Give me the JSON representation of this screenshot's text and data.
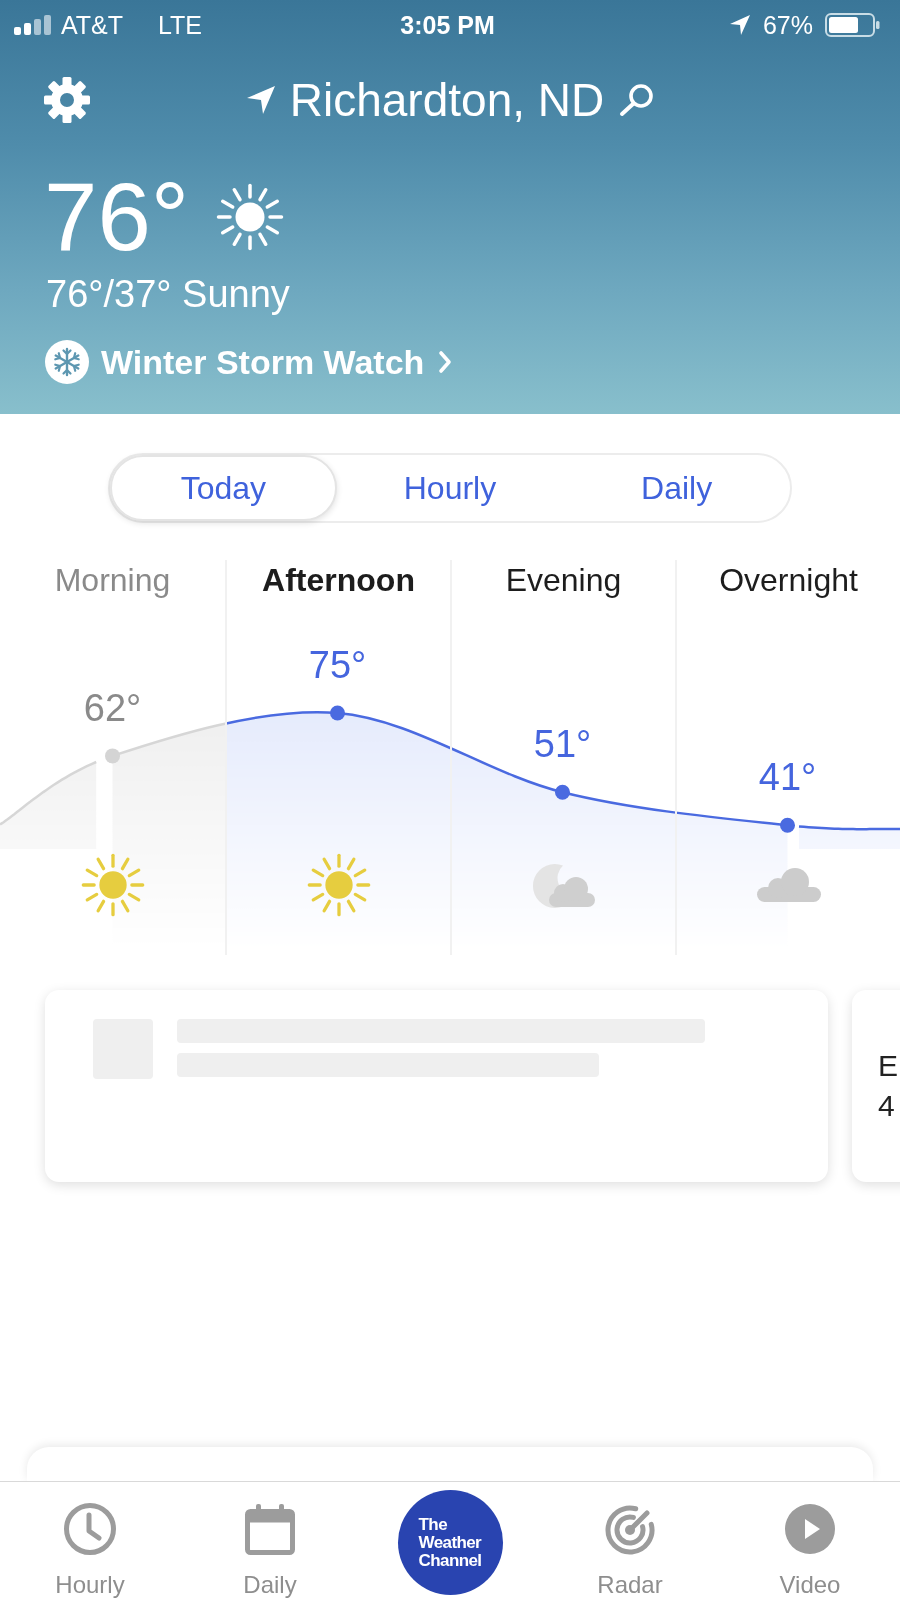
{
  "status_bar": {
    "carrier": "AT&T",
    "network": "LTE",
    "time": "3:05 PM",
    "battery": "67%"
  },
  "header": {
    "location": "Richardton, ND",
    "temperature": "76°",
    "summary": "76°/37° Sunny",
    "alert": "Winter Storm Watch"
  },
  "tabs": [
    {
      "label": "Today",
      "selected": true
    },
    {
      "label": "Hourly",
      "selected": false
    },
    {
      "label": "Daily",
      "selected": false
    }
  ],
  "forecast": {
    "chart_data": {
      "type": "area",
      "marker": "circle",
      "categories": [
        "Morning",
        "Afternoon",
        "Evening",
        "Overnight"
      ],
      "values": [
        62,
        75,
        51,
        41
      ],
      "value_labels": [
        "62°",
        "75°",
        "51°",
        "41°"
      ]
    },
    "periods": [
      {
        "kind": "sunny",
        "past": true,
        "selected": false
      },
      {
        "kind": "sunny",
        "past": false,
        "selected": true
      },
      {
        "kind": "night-cloudy",
        "past": false,
        "selected": false
      },
      {
        "kind": "cloudy",
        "past": false,
        "selected": false
      }
    ]
  },
  "cards": [
    {
      "kind": "loading"
    },
    {
      "kind": "text",
      "lines": [
        "E",
        "4"
      ]
    }
  ],
  "tab_bar": [
    {
      "kind": "clock",
      "label": "Hourly"
    },
    {
      "kind": "calendar",
      "label": "Daily"
    },
    {
      "kind": "logo",
      "label": "The Weather Channel"
    },
    {
      "kind": "radar",
      "label": "Radar"
    },
    {
      "kind": "video",
      "label": "Video"
    }
  ]
}
